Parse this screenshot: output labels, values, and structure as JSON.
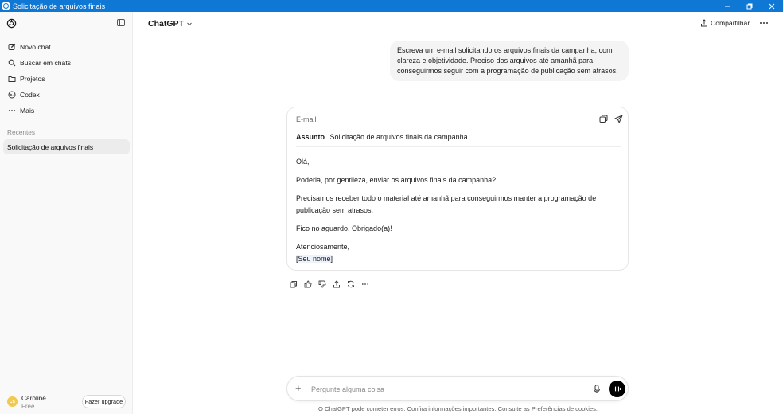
{
  "window": {
    "title": "Solicitação de arquivos finais",
    "titlebar_color": "#0f78d4"
  },
  "sidebar": {
    "items": [
      {
        "label": "Novo chat",
        "icon": "edit-icon"
      },
      {
        "label": "Buscar em chats",
        "icon": "search-icon"
      },
      {
        "label": "Projetos",
        "icon": "folder-icon"
      },
      {
        "label": "Codex",
        "icon": "codex-icon"
      },
      {
        "label": "Mais",
        "icon": "more-horizontal-icon"
      }
    ],
    "section_label": "Recentes",
    "recent": [
      {
        "label": "Solicitação de arquivos finais"
      }
    ],
    "user": {
      "initials": "CS",
      "name": "Caroline",
      "plan": "Free",
      "upgrade_label": "Fazer upgrade"
    }
  },
  "header": {
    "model": "ChatGPT",
    "share_label": "Compartilhar"
  },
  "conversation": {
    "user_message": "Escreva um e-mail solicitando os arquivos finais da campanha, com clareza e objetividade. Preciso dos arquivos até amanhã para conseguirmos seguir com a programação de publicação sem atrasos.",
    "email": {
      "label": "E-mail",
      "subject_label": "Assunto",
      "subject": "Solicitação de arquivos finais da campanha",
      "greeting": "Olá,",
      "p1": "Poderia, por gentileza, enviar os arquivos finais da campanha?",
      "p2": "Precisamos receber todo o material até amanhã para conseguirmos manter a programação de publicação sem atrasos.",
      "p3": "Fico no aguardo. Obrigado(a)!",
      "closing": "Atenciosamente,",
      "signature": "[Seu nome]"
    }
  },
  "composer": {
    "placeholder": "Pergunte alguma coisa"
  },
  "footer": {
    "note": "O ChatGPT pode cometer erros. Confira informações importantes. Consulte as",
    "link": "Preferências de cookies",
    "end": "."
  }
}
